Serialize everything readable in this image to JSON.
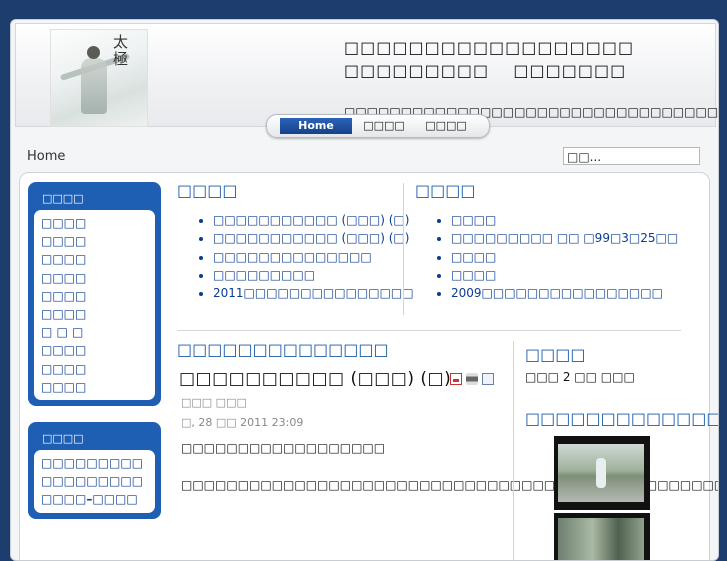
{
  "header": {
    "title_lines": [
      "□□□□□□□□□□□□□□□□□□",
      "□□□□□□□□□    □□□□□□□"
    ],
    "tagline": "□□□□□□□□□□□□□□□□□□□□□□□□□□□□□□□□□□□□□□ □□□□ ---- □□□□□□(□)",
    "logo_text": "太極"
  },
  "nav": {
    "tabs": [
      {
        "label": "Home",
        "active": true
      },
      {
        "label": "□□□□"
      },
      {
        "label": "□□□□"
      }
    ]
  },
  "breadcrumb": "Home",
  "search": {
    "value": "□□..."
  },
  "sidebar": {
    "menu1": {
      "title": "□□□□",
      "items": [
        "□□□□",
        "□□□□",
        "□□□□",
        "□□□□",
        "□□□□",
        "□□□□",
        "□ □ □",
        "□□□□",
        "□□□□",
        "□□□□"
      ]
    },
    "menu2": {
      "title": "□□□□",
      "items": [
        "□□□□□□□□□",
        "□□□□□□□□□",
        "□□□□–□□□□"
      ]
    }
  },
  "latest": {
    "title": "□□□□",
    "items": [
      "□□□□□□□□□□□ (□□□) (□)",
      "□□□□□□□□□□□ (□□□) (□)",
      "□□□□□□□□□□□□□□",
      "□□□□□□□□□",
      "2011□□□□□□□□□□□□□□□"
    ]
  },
  "popular": {
    "title": "□□□□",
    "items": [
      "□□□□",
      "□□□□□□□□□ □□ □99□3□25□□",
      "□□□□",
      "□□□□",
      "2009□□□□□□□□□□□□□□□□"
    ]
  },
  "article": {
    "section": "□□□□□□□□□□□□□□",
    "title": "□□□□□□□□□□ (□□□) (□)",
    "author": "□□□ □□□",
    "date": "□, 28 □□ 2011 23:09",
    "intro": "□□□□□□□□□□□□□□□□□□",
    "body": "□□□□□□□□□□□□□□□□□□□□□□□□□□□□□□□□□□□□□□□□□□□□□□□□□□□□□□□□□□□□□□□□□□□□□□□□□□□□□□□□□□□□□□□□□□□□□□□□□□□□□□□□□□□□□□□□□"
  },
  "right": {
    "online_title": "□□□□",
    "online_text": "□□□ 2 □□ □□□",
    "video_title": "□□□□□□□□□□□□□"
  }
}
